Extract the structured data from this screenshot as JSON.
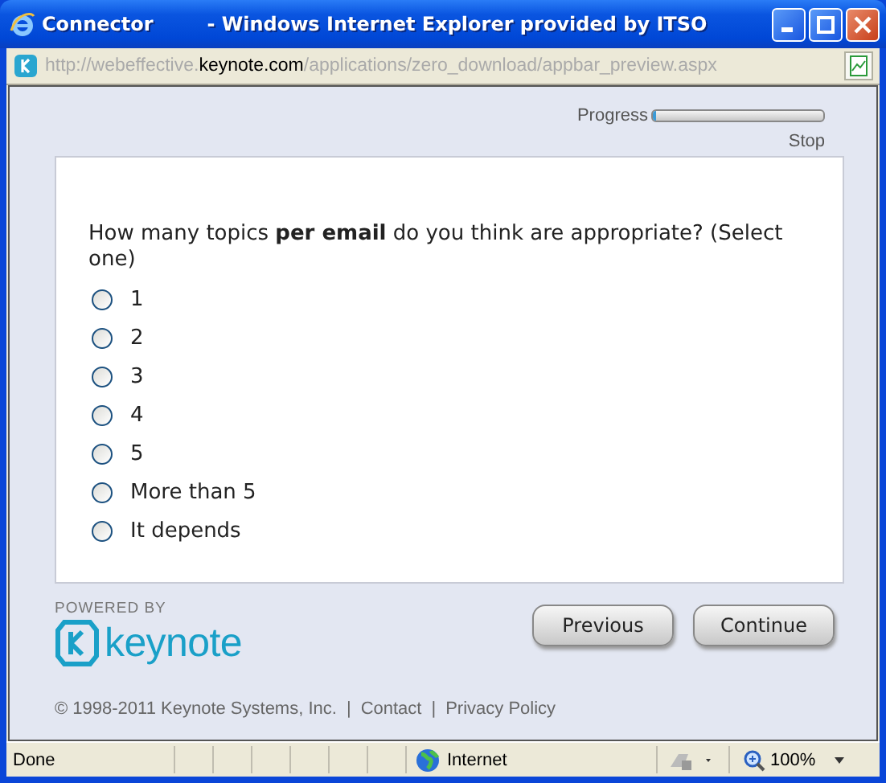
{
  "window": {
    "title": "Connector        - Windows Internet Explorer provided by ITSO"
  },
  "address_bar": {
    "prefix": "http://webeffective.",
    "domain": "keynote.com",
    "path": "/applications/zero_download/appbar_preview.aspx"
  },
  "progress": {
    "label": "Progress",
    "level": 0.02,
    "stop": "Stop"
  },
  "question": {
    "text": "How many topics **per email** do you think are appropriate? (Select one)",
    "options": [
      {
        "label": "1",
        "selected": false
      },
      {
        "label": "2",
        "selected": false
      },
      {
        "label": "3",
        "selected": false
      },
      {
        "label": "4",
        "selected": false
      },
      {
        "label": "5",
        "selected": false
      },
      {
        "label": "More than 5",
        "selected": false
      },
      {
        "label": "It depends",
        "selected": false
      }
    ]
  },
  "branding": {
    "powered_by": "POWERED BY",
    "logo": "keynote"
  },
  "buttons": [
    "Previous",
    "Continue"
  ],
  "footer": {
    "copyright": "© 1998-2011 Keynote Systems, Inc.",
    "separator": "|",
    "links": [
      "Contact",
      "Privacy Policy"
    ]
  },
  "status_bar": {
    "status": "Done",
    "zone": "Internet",
    "zoom": "100%"
  }
}
